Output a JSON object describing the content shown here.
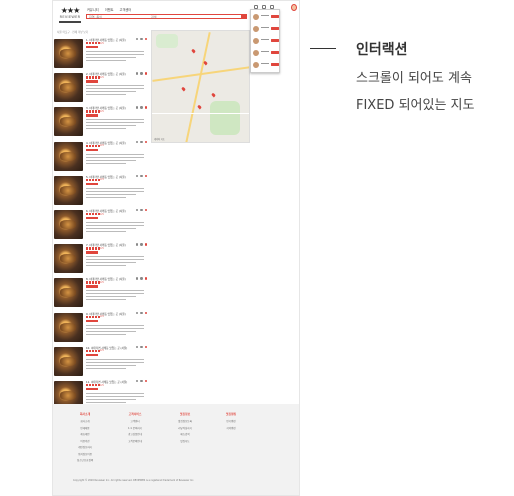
{
  "site": {
    "logo_stars": "★★★",
    "logo_word": "REVIEWER",
    "nav": [
      "커뮤니티",
      "이벤트",
      "고객센터"
    ],
    "search_placeholder": "지역, 음식",
    "search_middle": "검색",
    "breadcrumb": "서울 마포구 · 전체 리뷰 보기"
  },
  "listings": [
    {
      "title": "1. 이태리면 사케동 맛있는 곳 (서울)",
      "rating_text": "4.5"
    },
    {
      "title": "2. 이태리면 사케동 맛있는 곳 (서울)",
      "rating_text": "4.5"
    },
    {
      "title": "3. 이태리면 사케동 맛있는 곳 (서울)",
      "rating_text": "4.5"
    },
    {
      "title": "4. 이태리면 사케동 맛있는 곳 (서울)",
      "rating_text": "4.5"
    },
    {
      "title": "5. 이태리면 사케동 맛있는 곳 (서울)",
      "rating_text": "4.5"
    },
    {
      "title": "6. 이태리면 사케동 맛있는 곳 (서울)",
      "rating_text": "4.5"
    },
    {
      "title": "7. 이태리면 사케동 맛있는 곳 (서울)",
      "rating_text": "4.5"
    },
    {
      "title": "8. 이태리면 사케동 맛있는 곳 (서울)",
      "rating_text": "4.5"
    },
    {
      "title": "9. 이태리면 사케동 맛있는 곳 (서울)",
      "rating_text": "4.5"
    },
    {
      "title": "10. 이태리면 사케동 맛있는 곳 (서울)",
      "rating_text": "4.5"
    },
    {
      "title": "11. 이태리면 사케동 맛있는 곳 (서울)",
      "rating_text": "4.5"
    }
  ],
  "map": {
    "footer_text": "네이버 지도"
  },
  "footer": {
    "columns": [
      {
        "heading": "회사소개",
        "links": [
          "회사소개",
          "인재채용",
          "제휴제안",
          "이용약관",
          "개인정보처리",
          "위치정보이용",
          "청소년보호정책"
        ]
      },
      {
        "heading": "고객서비스",
        "links": [
          "고객센터",
          "1:1 문의하기",
          "광고상품안내",
          "고객문의안내"
        ]
      },
      {
        "heading": "맛집정보",
        "links": [
          "맛집정보등록",
          "리뷰작성하기",
          "메뉴검색",
          "맛집지도"
        ]
      },
      {
        "heading": "맛집랭킹",
        "links": [
          "인기랭킹",
          "지역랭킹"
        ]
      }
    ],
    "copyright": "Copyright © 2020 Reviewer Inc. All rights reserved. REVIEWER is a registered trademark of Reviewer Inc."
  },
  "annotation": {
    "title": "인터랙션",
    "desc_line1": "스크롤이 되어도 계속",
    "desc_line2": "FIXED 되어있는 지도"
  }
}
